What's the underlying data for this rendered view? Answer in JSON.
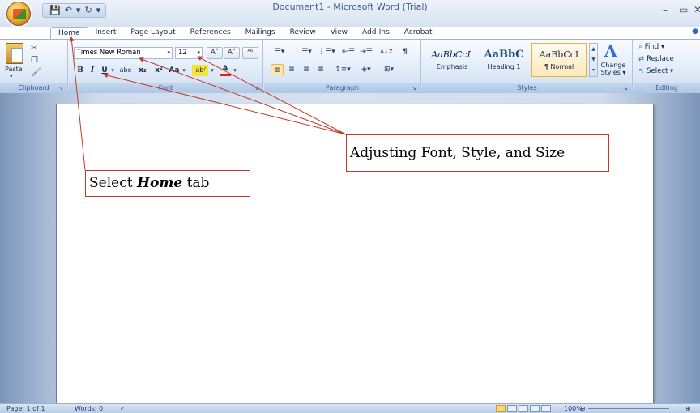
{
  "app": {
    "title": "Document1 - Microsoft Word (Trial)",
    "help_icon": "help-icon"
  },
  "quick_access": {
    "save_icon": "💾",
    "undo_icon": "↶",
    "undo_drop": "▾",
    "redo_icon": "↻",
    "customize_icon": "▾"
  },
  "window_controls": {
    "minimize": "–",
    "maximize": "▭",
    "close": "✕"
  },
  "tabs": [
    {
      "label": "Home",
      "active": true
    },
    {
      "label": "Insert"
    },
    {
      "label": "Page Layout"
    },
    {
      "label": "References"
    },
    {
      "label": "Mailings"
    },
    {
      "label": "Review"
    },
    {
      "label": "View"
    },
    {
      "label": "Add-Ins"
    },
    {
      "label": "Acrobat"
    }
  ],
  "ribbon": {
    "clipboard": {
      "label": "Clipboard",
      "paste_label": "Paste",
      "paste_drop": "▾",
      "cut_icon": "✂",
      "copy_icon": "❐",
      "format_painter_icon": "🖌"
    },
    "font": {
      "label": "Font",
      "font_name": "Times New Roman",
      "font_size": "12",
      "grow_label": "A˄",
      "shrink_label": "A˅",
      "clear_label": "ᴬᵇ",
      "bold": "B",
      "italic": "I",
      "underline": "U",
      "underline_drop": "▾",
      "strike": "abe",
      "subscript": "x₂",
      "superscript": "x²",
      "change_case": "Aa",
      "change_case_drop": "▾",
      "highlight": "ab⁄",
      "highlight_drop": "▾",
      "font_color": "A",
      "font_color_drop": "▾",
      "highlight_color": "#f5e33a",
      "font_color_value": "#e02020"
    },
    "paragraph": {
      "label": "Paragraph",
      "bullets": "☰▾",
      "numbering": "⒈☰▾",
      "multilevel": "⋮☰▾",
      "decrease_indent": "⇤☰",
      "increase_indent": "⇥☰",
      "sort": "A↓Z",
      "show_marks": "¶",
      "align_left": "≡",
      "align_center": "≡",
      "align_right": "≡",
      "justify": "≡",
      "line_spacing": "↕≡▾",
      "shading": "◈▾",
      "borders": "⊞▾"
    },
    "styles": {
      "label": "Styles",
      "items": [
        {
          "sample": "AaBbCcL",
          "name": "Emphasis"
        },
        {
          "sample": "AaBbC",
          "name": "Heading 1"
        },
        {
          "sample": "AaBbCcI",
          "name": "¶ Normal",
          "selected": true
        }
      ],
      "change_styles_label": "Change Styles ▾",
      "change_styles_icon": "A"
    },
    "editing": {
      "label": "Editing",
      "find": "Find ▾",
      "replace": "Replace",
      "select": "Select ▾",
      "find_icon": "🔭",
      "replace_icon": "ᵇac",
      "select_icon": "↖"
    }
  },
  "annotations": {
    "home_callout_prefix": "Select ",
    "home_callout_em": "Home",
    "home_callout_suffix": " tab",
    "font_callout": "Adjusting Font, Style, and Size"
  },
  "status_bar": {
    "page": "Page: 1 of 1",
    "words": "Words: 0",
    "proofing_icon": "✓",
    "zoom": "100%",
    "zoom_out": "⊖",
    "zoom_in": "⊕"
  }
}
